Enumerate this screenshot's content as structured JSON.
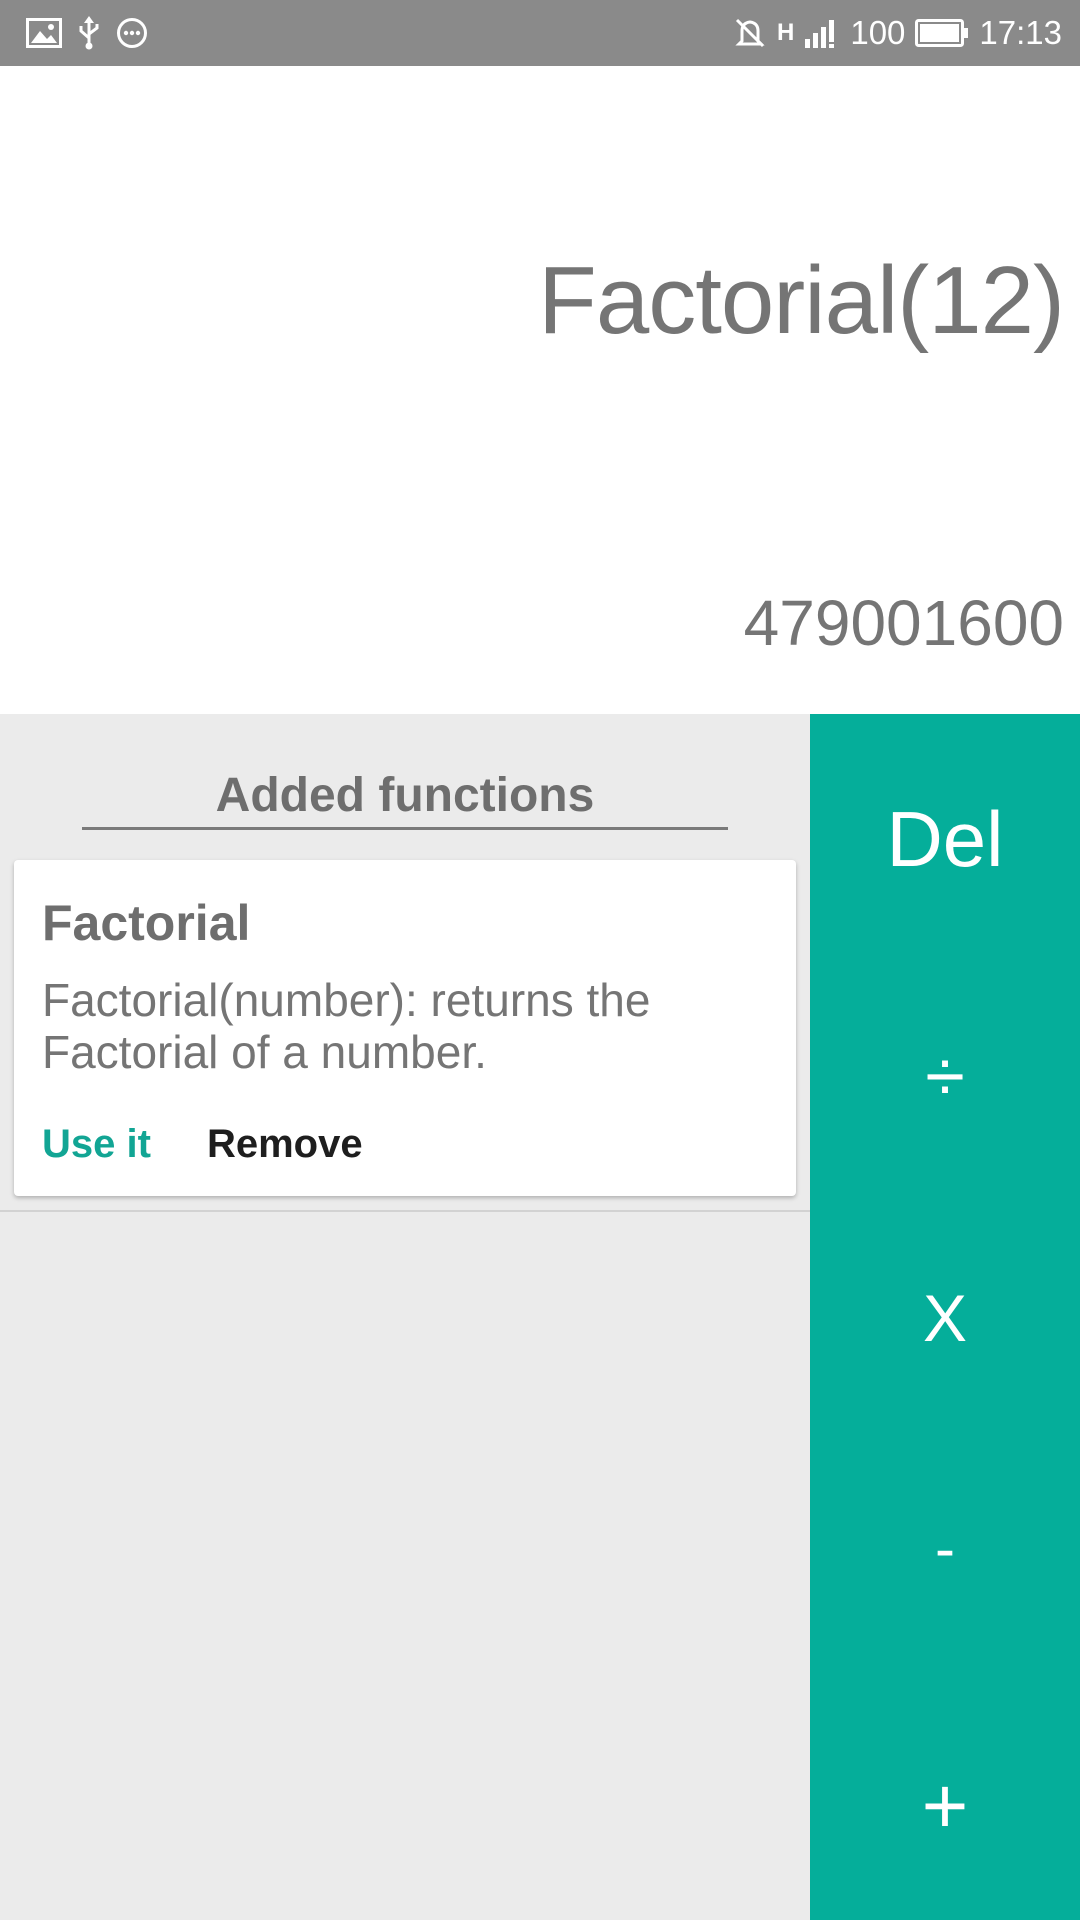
{
  "status_bar": {
    "left_icons": [
      "image-icon",
      "usb-icon",
      "more-icon"
    ],
    "network_type": "H",
    "battery_level": "100",
    "time": "17:13"
  },
  "display": {
    "expression": "Factorial(12)",
    "result": "479001600"
  },
  "functions_panel": {
    "header": "Added functions",
    "items": [
      {
        "title": "Factorial",
        "description": "Factorial(number): returns the Factorial of a number.",
        "use_label": "Use it",
        "remove_label": "Remove"
      }
    ]
  },
  "operators": {
    "del": "Del",
    "divide": "÷",
    "multiply": "X",
    "subtract": "-",
    "add": "+"
  },
  "colors": {
    "accent": "#05ae9a",
    "status_bar": "#8a8a8a",
    "panel_bg": "#ebebeb"
  }
}
